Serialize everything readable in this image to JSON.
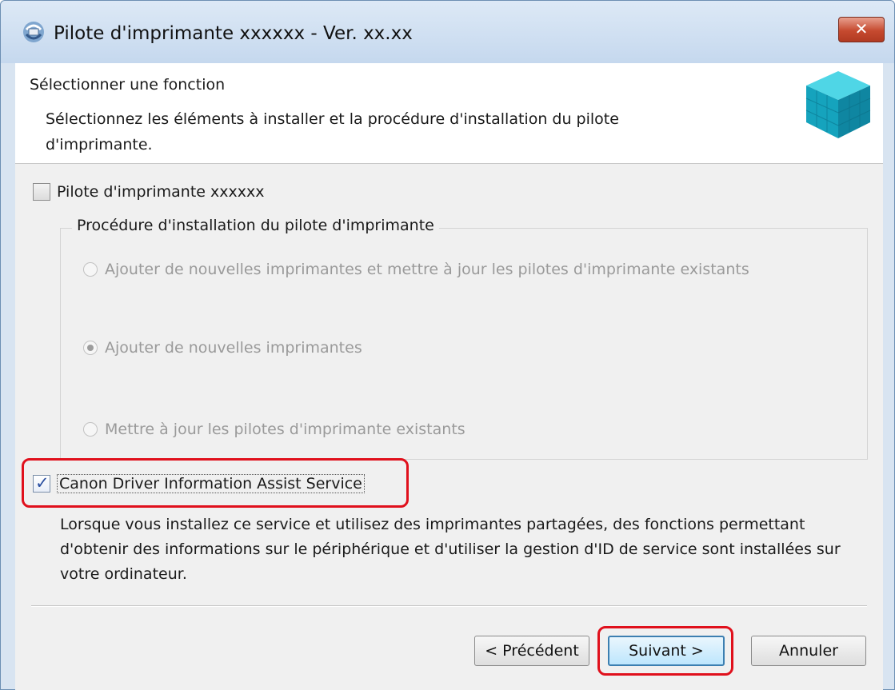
{
  "window": {
    "title": "Pilote d'imprimante xxxxxx - Ver. xx.xx",
    "close_label": "✕"
  },
  "header": {
    "title": "Sélectionner une fonction",
    "description": "Sélectionnez les éléments à installer et la procédure d'installation du pilote d'imprimante."
  },
  "driver_option": {
    "label": "Pilote d'imprimante xxxxxx",
    "checked": false
  },
  "procedure_group": {
    "legend": "Procédure d'installation du pilote d'imprimante",
    "options": [
      {
        "label": "Ajouter de nouvelles imprimantes et mettre à jour les pilotes d'imprimante existants",
        "selected": false,
        "enabled": false
      },
      {
        "label": "Ajouter de nouvelles imprimantes",
        "selected": true,
        "enabled": false
      },
      {
        "label": "Mettre à jour les pilotes d'imprimante existants",
        "selected": false,
        "enabled": false
      }
    ]
  },
  "assist_service": {
    "label": "Canon Driver Information Assist Service",
    "checked": true,
    "description": "Lorsque vous installez ce service et utilisez des imprimantes partagées, des fonctions permettant d'obtenir des informations sur le périphérique et d'utiliser la gestion d'ID de service sont installées sur votre ordinateur."
  },
  "buttons": {
    "back": "< Précédent",
    "next": "Suivant >",
    "cancel": "Annuler"
  },
  "colors": {
    "highlight": "#e0101c",
    "check_mark": "#2a4fa0",
    "close_button": "#c64a2f"
  }
}
